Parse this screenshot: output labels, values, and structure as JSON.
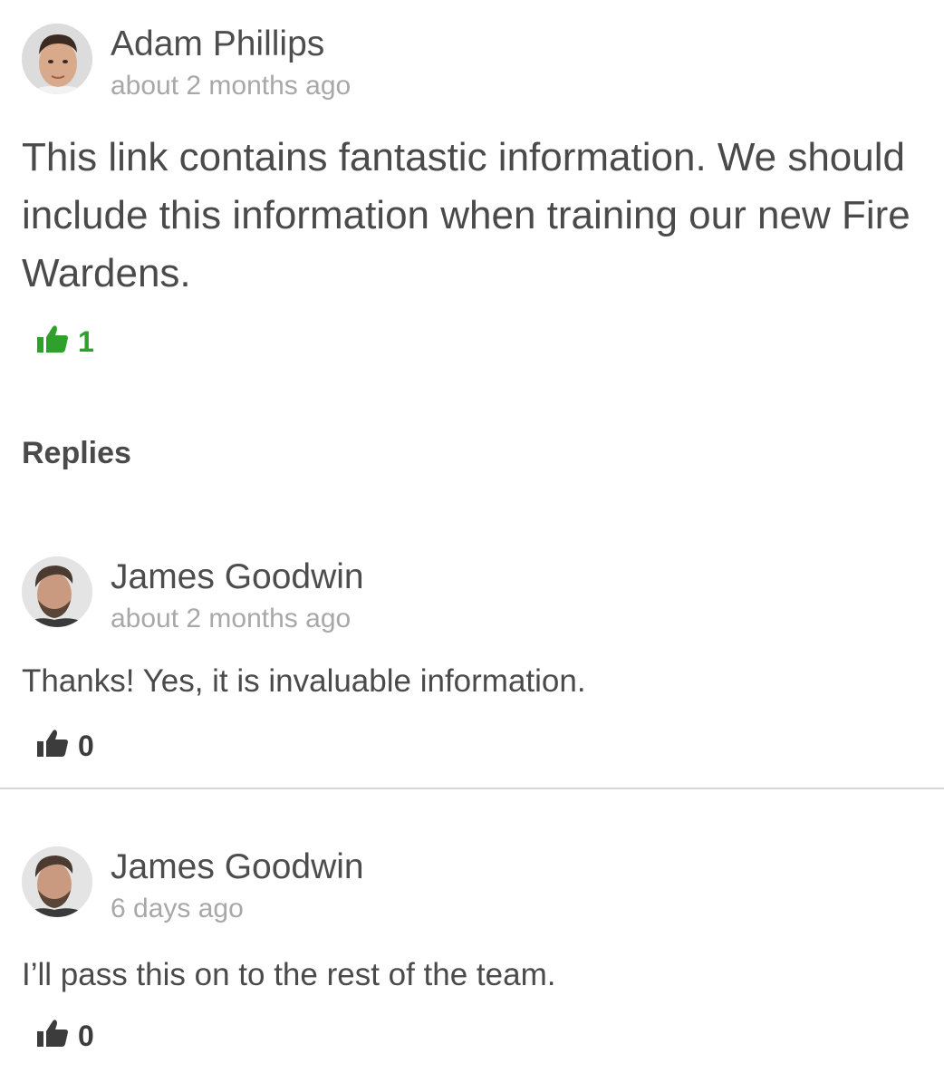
{
  "comment": {
    "author": "Adam Phillips",
    "time": "about 2 months ago",
    "body": "This link contains fantastic information. We should include this information when training our new Fire Wardens.",
    "likes": "1",
    "like_icon": "thumbs-up-icon",
    "like_color": "#2fa02c"
  },
  "replies_heading": "Replies",
  "replies": [
    {
      "author": "James Goodwin",
      "time": "about 2 months ago",
      "body": "Thanks! Yes, it is invaluable information.",
      "likes": "0",
      "like_icon": "thumbs-up-icon"
    },
    {
      "author": "James Goodwin",
      "time": "6 days ago",
      "body": "I’ll pass this on to the rest of the team.",
      "likes": "0",
      "like_icon": "thumbs-up-icon"
    }
  ],
  "colors": {
    "text": "#4a4a4a",
    "muted": "#a8a8a8",
    "like_active": "#2fa02c",
    "like_idle": "#3c3c3c",
    "divider": "#d6d6d6"
  }
}
